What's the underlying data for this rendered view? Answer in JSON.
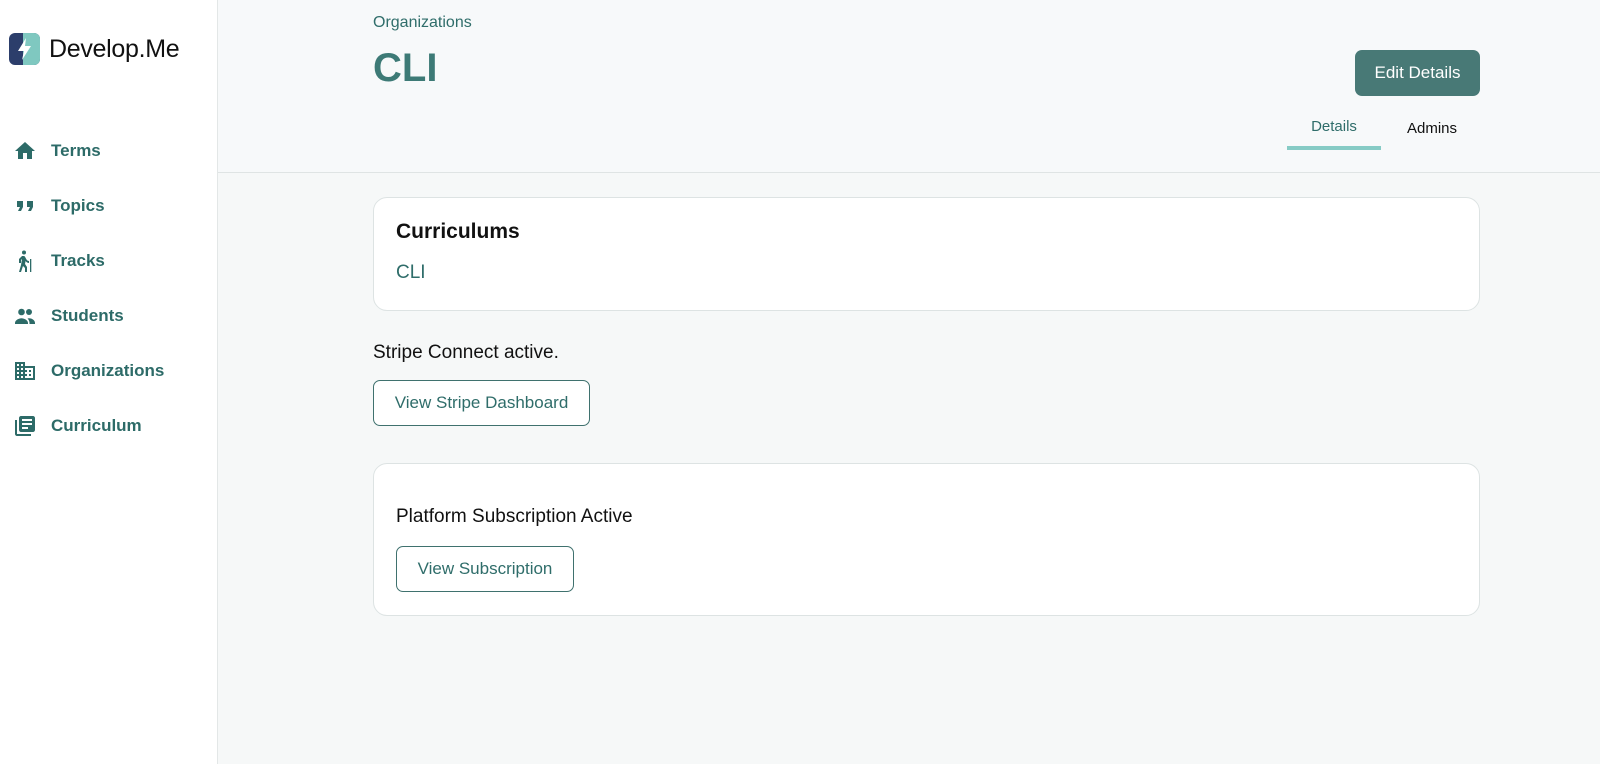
{
  "brand": {
    "name": "Develop.Me"
  },
  "sidebar": {
    "items": [
      {
        "label": "Terms",
        "icon": "home-icon"
      },
      {
        "label": "Topics",
        "icon": "quote-icon"
      },
      {
        "label": "Tracks",
        "icon": "hiker-icon"
      },
      {
        "label": "Students",
        "icon": "people-icon"
      },
      {
        "label": "Organizations",
        "icon": "building-icon"
      },
      {
        "label": "Curriculum",
        "icon": "library-icon"
      }
    ]
  },
  "header": {
    "breadcrumb": "Organizations",
    "title": "CLI",
    "edit_label": "Edit Details",
    "tabs": [
      {
        "label": "Details",
        "active": true
      },
      {
        "label": "Admins",
        "active": false
      }
    ]
  },
  "curriculums": {
    "title": "Curriculums",
    "items": [
      "CLI"
    ]
  },
  "stripe": {
    "status": "Stripe Connect active.",
    "button_label": "View Stripe Dashboard"
  },
  "subscription": {
    "status": "Platform Subscription Active",
    "button_label": "View Subscription"
  },
  "colors": {
    "accent": "#2f6d6a",
    "button_fill": "#487976",
    "tab_underline": "#86cbc5"
  }
}
